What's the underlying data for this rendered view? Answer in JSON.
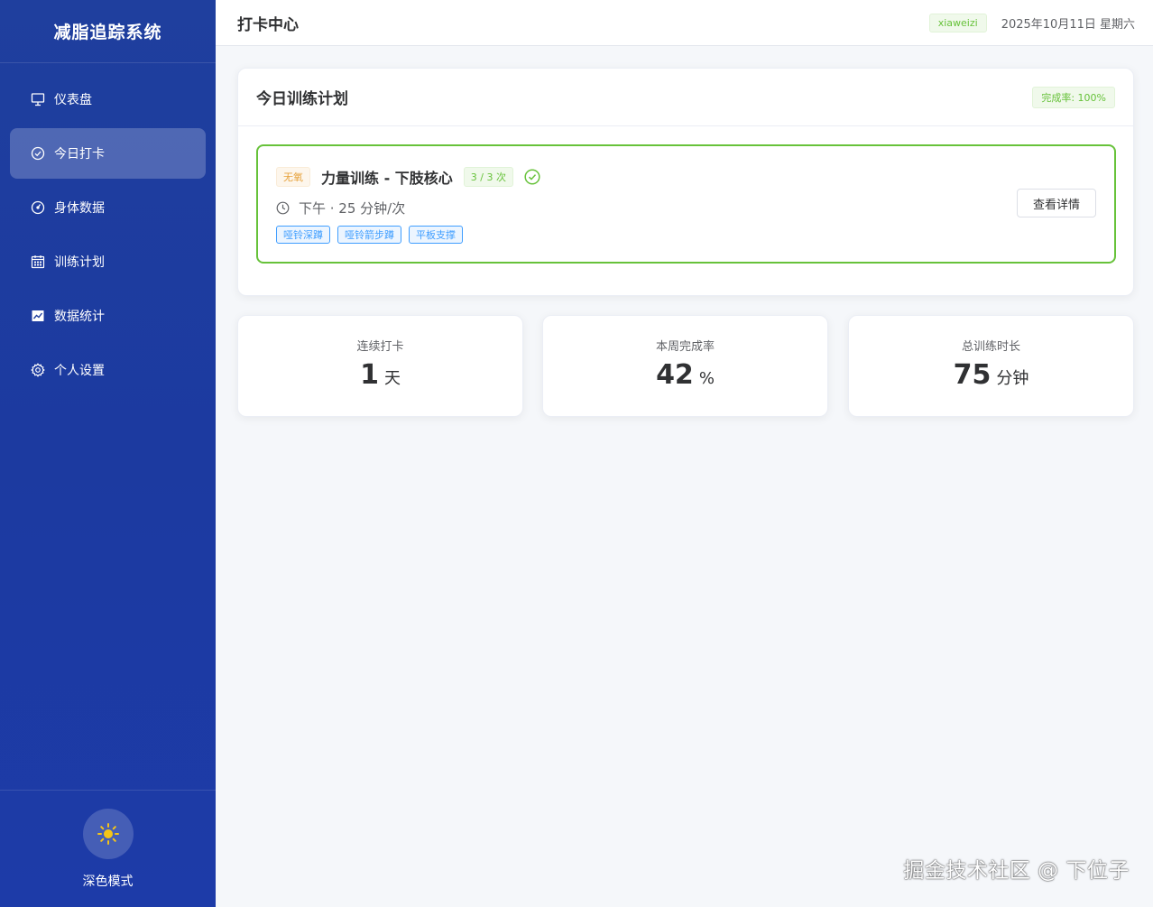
{
  "sidebar": {
    "brand": "减脂追踪系统",
    "items": [
      {
        "label": "仪表盘",
        "icon": "presentation-board-icon"
      },
      {
        "label": "今日打卡",
        "icon": "check-circle-icon",
        "active": true
      },
      {
        "label": "身体数据",
        "icon": "gauge-icon"
      },
      {
        "label": "训练计划",
        "icon": "calendar-icon"
      },
      {
        "label": "数据统计",
        "icon": "trend-chart-icon"
      },
      {
        "label": "个人设置",
        "icon": "gear-icon"
      }
    ],
    "theme_toggle": {
      "label": "深色模式",
      "icon": "sun-icon"
    }
  },
  "header": {
    "title": "打卡中心",
    "user": "xiaweizi",
    "date": "2025年10月11日 星期六"
  },
  "plan": {
    "title": "今日训练计划",
    "completion_badge": "完成率: 100%",
    "task": {
      "type_tag": "无氧",
      "name": "力量训练 - 下肢核心",
      "count_tag": "3 / 3 次",
      "schedule": "下午 · 25 分钟/次",
      "exercises": [
        "哑铃深蹲",
        "哑铃箭步蹲",
        "平板支撑"
      ],
      "detail_button": "查看详情"
    }
  },
  "stats": [
    {
      "label": "连续打卡",
      "value": "1",
      "unit": "天"
    },
    {
      "label": "本周完成率",
      "value": "42",
      "unit": "%"
    },
    {
      "label": "总训练时长",
      "value": "75",
      "unit": "分钟"
    }
  ],
  "watermark": "掘金技术社区 @ 下位子",
  "colors": {
    "sidebar_bg": "#1c3aa0",
    "success": "#67c23a",
    "warning": "#e6a23c",
    "primary": "#409eff",
    "sun": "#f5c518"
  }
}
